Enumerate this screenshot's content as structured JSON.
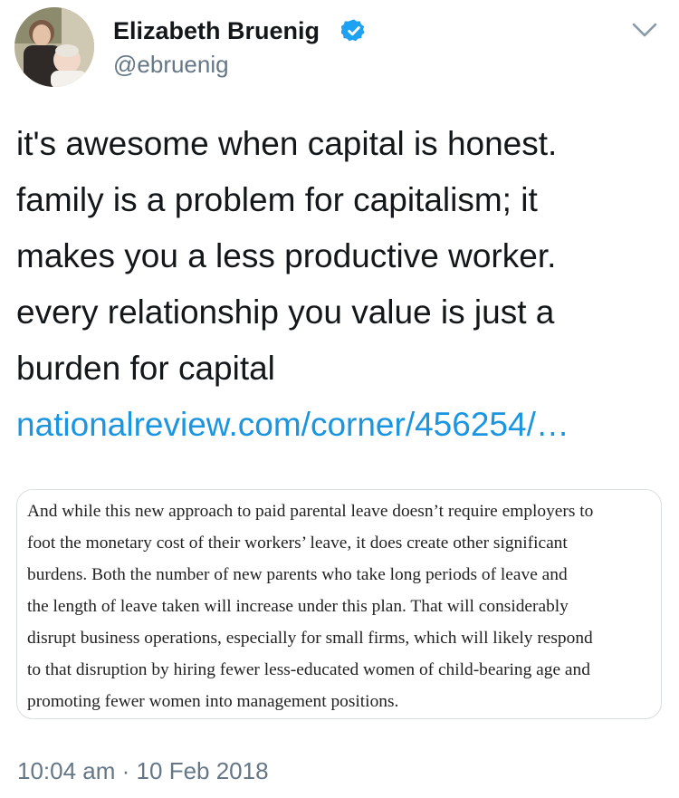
{
  "author": {
    "name": "Elizabeth Bruenig",
    "handle": "@ebruenig",
    "verified_icon": "verified-badge-icon",
    "avatar_icon": "profile-photo"
  },
  "menu_icon": "chevron-down-icon",
  "tweet": {
    "lines": [
      "it's awesome when capital is honest.",
      "family is a problem for capitalism; it",
      "makes you a less productive worker.",
      "every relationship you value is just a",
      "burden for capital"
    ],
    "link_text": "nationalreview.com/corner/456254/…"
  },
  "quote_image": {
    "lines": [
      "And while this new approach to paid parental leave doesn’t require employers to",
      "foot the monetary cost of their workers’ leave, it does create other significant",
      "burdens. Both the number of new parents who take long periods of leave and",
      "the length of leave taken will increase under this plan. That will considerably",
      "disrupt business operations, especially for small firms, which will likely respond",
      "to that disruption by hiring fewer less-educated women of child-bearing age and",
      "promoting fewer women into management positions."
    ]
  },
  "timestamp": {
    "time": "10:04 am",
    "separator": "·",
    "date": "10 Feb 2018"
  },
  "colors": {
    "link": "#1b95e0",
    "secondary_text": "#657786",
    "verified": "#1da1f2",
    "card_border": "#d8dee3"
  }
}
